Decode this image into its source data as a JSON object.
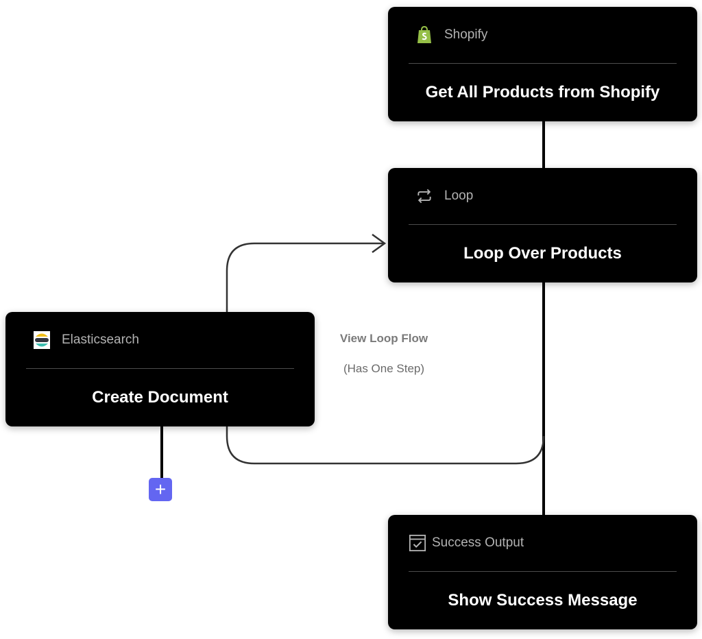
{
  "nodes": {
    "shopify": {
      "service": "Shopify",
      "title": "Get All Products from Shopify",
      "icon": "shopify-bag-icon",
      "icon_color": "#95bf47"
    },
    "loop": {
      "service": "Loop",
      "title": "Loop Over Products",
      "icon": "loop-arrows-icon"
    },
    "elasticsearch": {
      "service": "Elasticsearch",
      "title": "Create Document",
      "icon": "elasticsearch-logo-icon"
    },
    "success": {
      "service": "Success Output",
      "title": "Show Success Message",
      "icon": "checkbox-icon"
    }
  },
  "loop_flow": {
    "title": "View Loop Flow",
    "subtitle": "(Has One Step)"
  },
  "add_step": {
    "label": "+",
    "color": "#6366f1"
  }
}
